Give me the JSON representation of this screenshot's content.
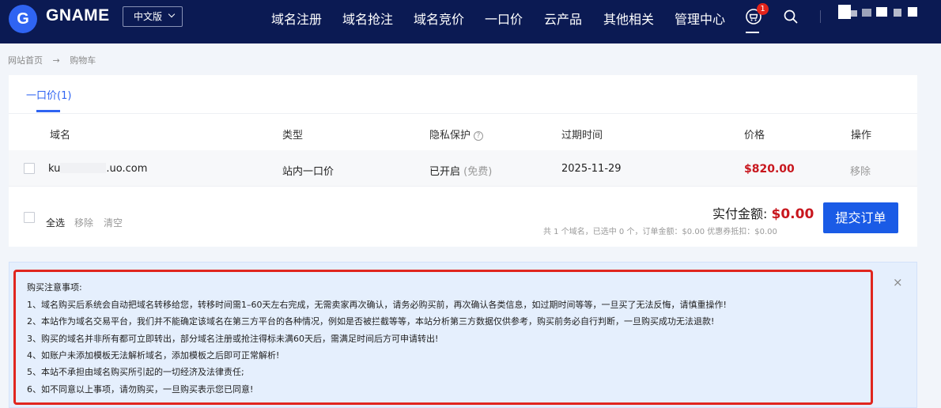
{
  "header": {
    "logo_letter": "G",
    "brand": "GNAME",
    "language": "中文版",
    "nav": [
      "域名注册",
      "域名抢注",
      "域名竞价",
      "一口价",
      "云产品",
      "其他相关",
      "管理中心"
    ],
    "cart_count": "1",
    "icons": [
      "cart-icon",
      "search-icon",
      "chevron-down-icon"
    ]
  },
  "breadcrumb": {
    "home": "网站首页",
    "separator": "→",
    "current": "购物车"
  },
  "cart": {
    "tab_label": "一口价(1)",
    "columns": {
      "domain": "域名",
      "type": "类型",
      "privacy": "隐私保护",
      "expire": "过期时间",
      "price": "价格",
      "action": "操作"
    },
    "help_glyph": "?",
    "rows": [
      {
        "domain_prefix": "ku",
        "domain_suffix": ".uo.com",
        "type": "站内一口价",
        "privacy": "已开启",
        "privacy_note": "(免费)",
        "expire": "2025-11-29",
        "price": "$820.00",
        "action": "移除"
      }
    ],
    "footer": {
      "select_all": "全选",
      "remove": "移除",
      "clear": "清空",
      "pay_label": "实付金额:",
      "pay_amount": "$0.00",
      "summary": "共 1 个域名，已选中 0 个，订单金额：$0.00 优惠券抵扣：$0.00",
      "submit": "提交订单"
    }
  },
  "notice": {
    "title": "购买注意事项:",
    "items": [
      "1、域名购买后系统会自动把域名转移给您，转移时间需1–60天左右完成，无需卖家再次确认，请务必购买前，再次确认各类信息，如过期时间等等，一旦买了无法反悔，请慎重操作!",
      "2、本站作为域名交易平台，我们并不能确定该域名在第三方平台的各种情况，例如是否被拦截等等，本站分析第三方数据仅供参考，购买前务必自行判断，一旦购买成功无法退款!",
      "3、购买的域名并非所有都可立即转出，部分域名注册或抢注得标未满60天后，需满足时间后方可申请转出!",
      "4、如账户未添加模板无法解析域名，添加模板之后即可正常解析!",
      "5、本站不承担由域名购买所引起的一切经济及法律责任;",
      "6、如不同意以上事项，请勿购买，一旦购买表示您已同意!"
    ],
    "close": "×"
  },
  "colors": {
    "nav_bg": "#0b1a53",
    "accent": "#2f64f2",
    "price_red": "#c8171e",
    "submit_bg": "#1a5be6",
    "notice_bg": "#e5effd",
    "highlight_border": "#e0261e"
  }
}
